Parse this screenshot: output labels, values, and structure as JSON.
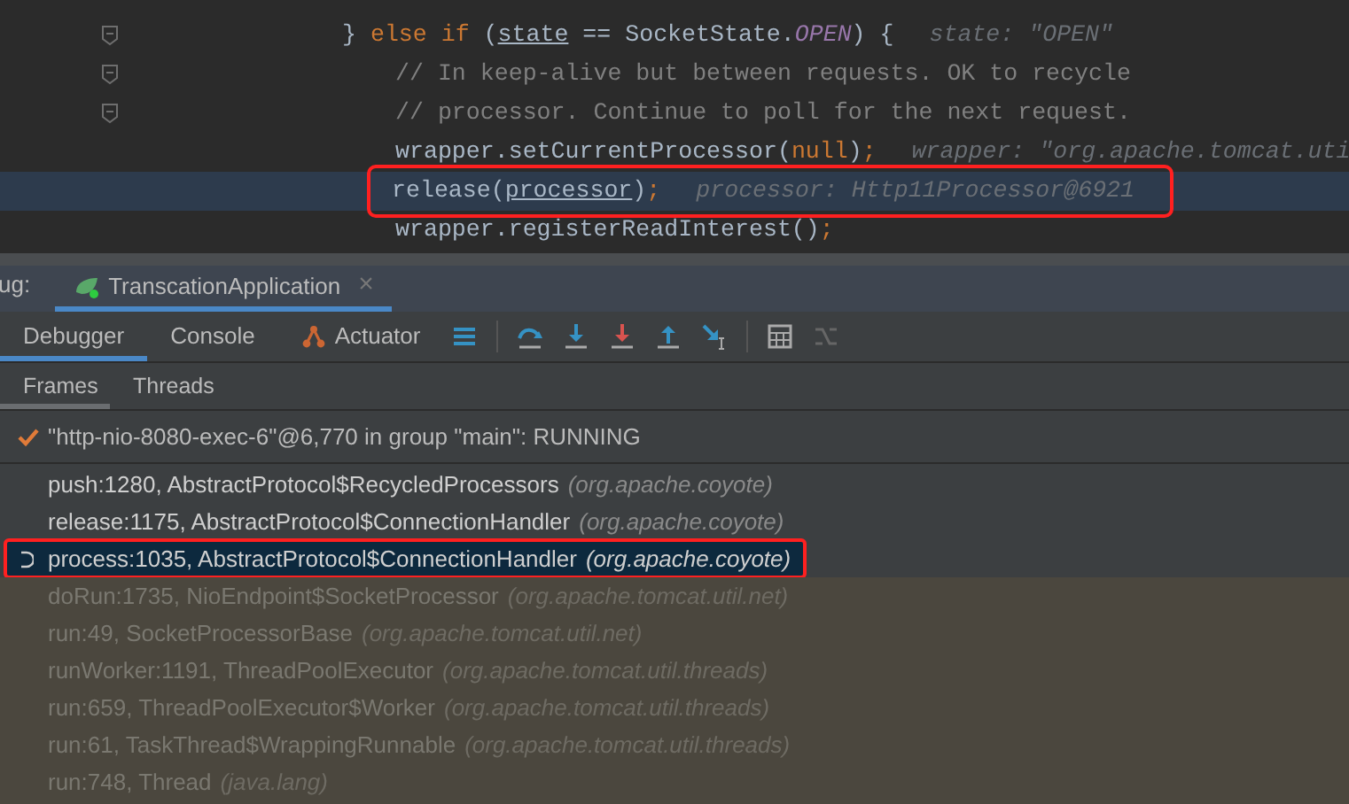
{
  "editor": {
    "lines": [
      {
        "fold": true,
        "current": false,
        "boxed": false,
        "tokens": [
          {
            "t": "} ",
            "kind": "text"
          },
          {
            "t": "else if",
            "kind": "keyword"
          },
          {
            "t": " (",
            "kind": "text"
          },
          {
            "t": "state",
            "kind": "var"
          },
          {
            "t": " == SocketState.",
            "kind": "text"
          },
          {
            "t": "OPEN",
            "kind": "constant"
          },
          {
            "t": ") {",
            "kind": "text"
          }
        ],
        "hint": "state: \"OPEN\"",
        "children": [
          {
            "fold": true,
            "current": false,
            "boxed": false,
            "tokens": [
              {
                "t": "// In keep-alive but between requests. OK to recycle",
                "kind": "comment"
              }
            ]
          },
          {
            "fold": true,
            "current": false,
            "boxed": false,
            "tokens": [
              {
                "t": "// processor. Continue to poll for the next request.",
                "kind": "comment"
              }
            ]
          },
          {
            "fold": false,
            "current": false,
            "boxed": false,
            "tokens": [
              {
                "t": "wrapper.setCurrentProcessor(",
                "kind": "text"
              },
              {
                "t": "null",
                "kind": "keyword"
              },
              {
                "t": ")",
                "kind": "text"
              },
              {
                "t": ";",
                "kind": "keyword"
              }
            ],
            "hint": "wrapper: \"org.apache.tomcat.uti"
          },
          {
            "fold": false,
            "current": true,
            "boxed": true,
            "tokens": [
              {
                "t": "release(",
                "kind": "text"
              },
              {
                "t": "processor",
                "kind": "var"
              },
              {
                "t": ")",
                "kind": "text"
              },
              {
                "t": ";",
                "kind": "keyword"
              }
            ],
            "hint": "processor: Http11Processor@6921"
          },
          {
            "fold": false,
            "current": false,
            "boxed": false,
            "tokens": [
              {
                "t": "wrapper.registerReadInterest()",
                "kind": "text"
              },
              {
                "t": ";",
                "kind": "keyword"
              }
            ]
          }
        ]
      }
    ]
  },
  "debug_bar": {
    "label": "ug:",
    "session_tab": "TranscationApplication",
    "close": "×"
  },
  "tabs": [
    {
      "label": "Debugger",
      "selected": true
    },
    {
      "label": "Console",
      "selected": false
    },
    {
      "label": "Actuator",
      "selected": false
    }
  ],
  "subtabs": [
    {
      "label": "Frames",
      "selected": true
    },
    {
      "label": "Threads",
      "selected": false
    }
  ],
  "thread": "\"http-nio-8080-exec-6\"@6,770 in group \"main\": RUNNING",
  "frames": [
    {
      "method": "push:1280, AbstractProtocol$RecycledProcessors",
      "package": "(org.apache.coyote)",
      "kind": "app",
      "selected": false,
      "boxed": false
    },
    {
      "method": "release:1175, AbstractProtocol$ConnectionHandler",
      "package": "(org.apache.coyote)",
      "kind": "app",
      "selected": false,
      "boxed": false
    },
    {
      "method": "process:1035, AbstractProtocol$ConnectionHandler",
      "package": "(org.apache.coyote)",
      "kind": "app",
      "selected": true,
      "boxed": true
    },
    {
      "method": "doRun:1735, NioEndpoint$SocketProcessor",
      "package": "(org.apache.tomcat.util.net)",
      "kind": "library",
      "selected": false,
      "boxed": false
    },
    {
      "method": "run:49, SocketProcessorBase",
      "package": "(org.apache.tomcat.util.net)",
      "kind": "library",
      "selected": false,
      "boxed": false
    },
    {
      "method": "runWorker:1191, ThreadPoolExecutor",
      "package": "(org.apache.tomcat.util.threads)",
      "kind": "library",
      "selected": false,
      "boxed": false
    },
    {
      "method": "run:659, ThreadPoolExecutor$Worker",
      "package": "(org.apache.tomcat.util.threads)",
      "kind": "library",
      "selected": false,
      "boxed": false
    },
    {
      "method": "run:61, TaskThread$WrappingRunnable",
      "package": "(org.apache.tomcat.util.threads)",
      "kind": "library",
      "selected": false,
      "boxed": false
    },
    {
      "method": "run:748, Thread",
      "package": "(java.lang)",
      "kind": "library",
      "selected": false,
      "boxed": false
    }
  ]
}
